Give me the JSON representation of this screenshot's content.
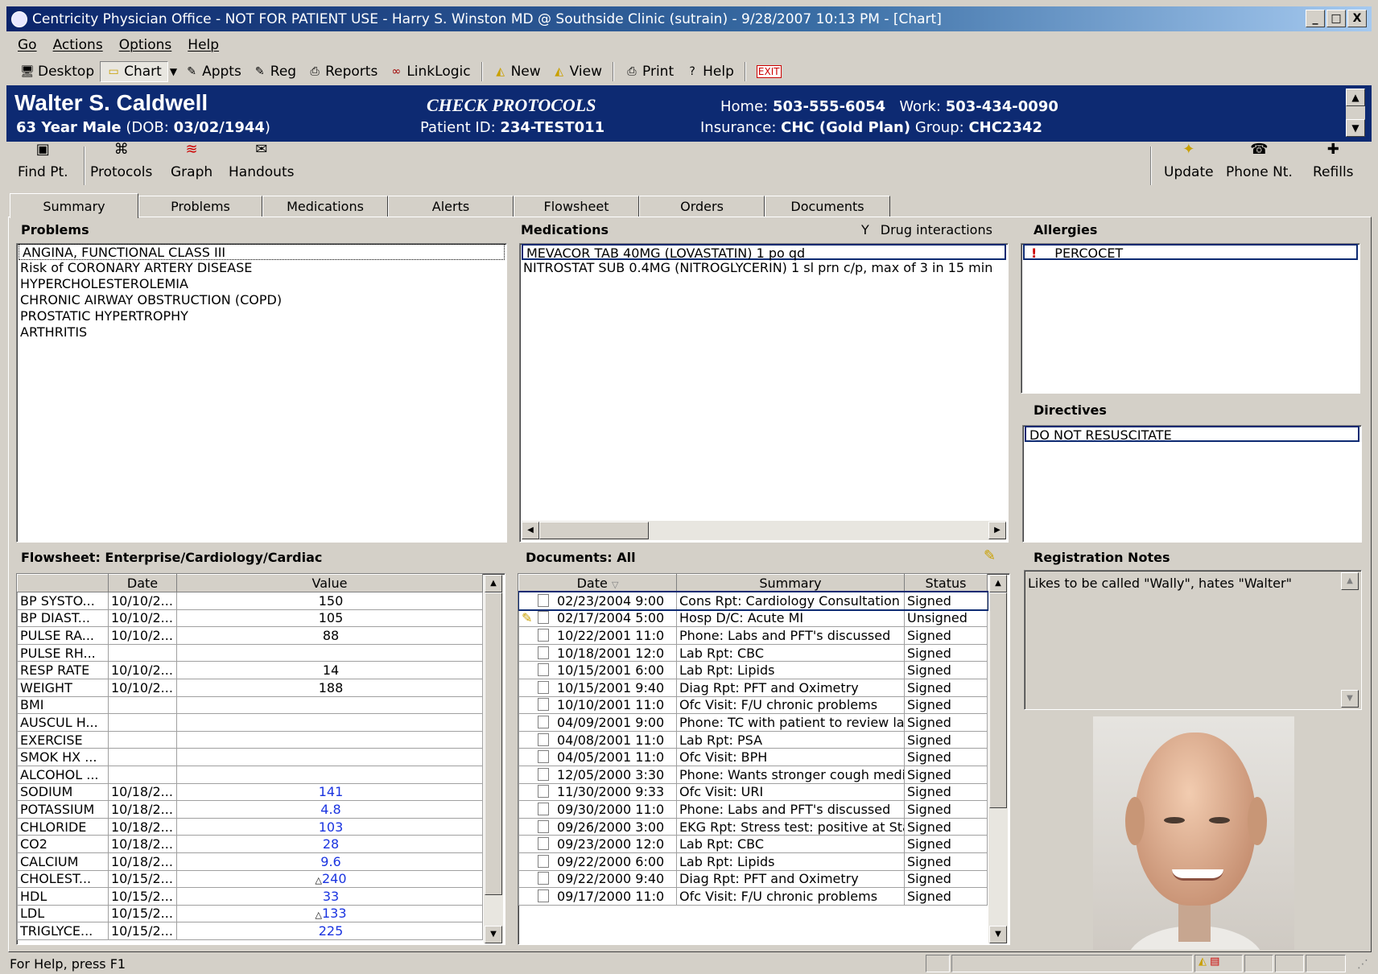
{
  "window": {
    "title": "Centricity Physician Office - NOT FOR PATIENT USE  -  Harry S. Winston MD @ Southside Clinic (sutrain)  -  9/28/2007  10:13 PM - [Chart]",
    "minimize": "_",
    "maximize": "□",
    "close": "X"
  },
  "menu": {
    "items": [
      "Go",
      "Actions",
      "Options",
      "Help"
    ]
  },
  "toolbar": {
    "desktop": "Desktop",
    "chart": "Chart",
    "appts": "Appts",
    "reg": "Reg",
    "reports": "Reports",
    "linklogic": "LinkLogic",
    "new": "New",
    "view": "View",
    "print": "Print",
    "help": "Help",
    "exit": "EXIT"
  },
  "patient": {
    "name": "Walter S. Caldwell",
    "age_sex": "63 Year Male",
    "dob_label": "(DOB: ",
    "dob": "03/02/1944",
    "dob_close": ")",
    "check_protocols": "CHECK PROTOCOLS",
    "patient_id_label": "Patient ID: ",
    "patient_id": "234-TEST011",
    "home_label": "Home: ",
    "home": "503-555-6054",
    "work_label": "Work: ",
    "work": "503-434-0090",
    "insurance_label": "Insurance: ",
    "insurance": "CHC (Gold Plan)",
    "group_label": "Group: ",
    "group": "CHC2342"
  },
  "actions": {
    "find_pt": "Find Pt.",
    "protocols": "Protocols",
    "graph": "Graph",
    "handouts": "Handouts",
    "update": "Update",
    "phone_nt": "Phone Nt.",
    "refills": "Refills"
  },
  "tabs": [
    "Summary",
    "Problems",
    "Medications",
    "Alerts",
    "Flowsheet",
    "Orders",
    "Documents"
  ],
  "problems": {
    "header": "Problems",
    "items": [
      "ANGINA, FUNCTIONAL CLASS III",
      "Risk of CORONARY ARTERY DISEASE",
      "HYPERCHOLESTEROLEMIA",
      "CHRONIC AIRWAY OBSTRUCTION (COPD)",
      "PROSTATIC HYPERTROPHY",
      "ARTHRITIS"
    ]
  },
  "medications": {
    "header": "Medications",
    "drug_interactions": "Drug interactions",
    "items": [
      "MEVACOR TAB 40MG (LOVASTATIN) 1 po qd",
      "NITROSTAT SUB 0.4MG (NITROGLYCERIN) 1 sl prn c/p, max of 3 in 15 min"
    ]
  },
  "allergies": {
    "header": "Allergies",
    "items": [
      "PERCOCET"
    ]
  },
  "directives": {
    "header": "Directives",
    "items": [
      "DO NOT RESUSCITATE"
    ]
  },
  "flowsheet": {
    "header": "Flowsheet:  Enterprise/Cardiology/Cardiac",
    "columns": [
      "",
      "Date",
      "Value"
    ],
    "rows": [
      {
        "name": "BP SYSTO...",
        "date": "10/10/2...",
        "value": "150",
        "flag": ""
      },
      {
        "name": "BP DIAST...",
        "date": "10/10/2...",
        "value": "105",
        "flag": ""
      },
      {
        "name": "PULSE RA...",
        "date": "10/10/2...",
        "value": "88",
        "flag": ""
      },
      {
        "name": "PULSE RH...",
        "date": "",
        "value": "",
        "flag": ""
      },
      {
        "name": "RESP RATE",
        "date": "10/10/2...",
        "value": "14",
        "flag": ""
      },
      {
        "name": "WEIGHT",
        "date": "10/10/2...",
        "value": "188",
        "flag": ""
      },
      {
        "name": "BMI",
        "date": "",
        "value": "",
        "flag": ""
      },
      {
        "name": "AUSCUL H...",
        "date": "",
        "value": "",
        "flag": ""
      },
      {
        "name": "EXERCISE",
        "date": "",
        "value": "",
        "flag": ""
      },
      {
        "name": "SMOK HX ...",
        "date": "",
        "value": "",
        "flag": ""
      },
      {
        "name": "ALCOHOL ...",
        "date": "",
        "value": "",
        "flag": ""
      },
      {
        "name": "SODIUM",
        "date": "10/18/2...",
        "value": "141",
        "flag": "blue"
      },
      {
        "name": "POTASSIUM",
        "date": "10/18/2...",
        "value": "4.8",
        "flag": "blue"
      },
      {
        "name": "CHLORIDE",
        "date": "10/18/2...",
        "value": "103",
        "flag": "blue"
      },
      {
        "name": "CO2",
        "date": "10/18/2...",
        "value": "28",
        "flag": "blue"
      },
      {
        "name": "CALCIUM",
        "date": "10/18/2...",
        "value": "9.6",
        "flag": "blue"
      },
      {
        "name": "CHOLEST...",
        "date": "10/15/2...",
        "value": "240",
        "flag": "high"
      },
      {
        "name": "HDL",
        "date": "10/15/2...",
        "value": "33",
        "flag": "blue"
      },
      {
        "name": "LDL",
        "date": "10/15/2...",
        "value": "133",
        "flag": "high"
      },
      {
        "name": "TRIGLYCE...",
        "date": "10/15/2...",
        "value": "225",
        "flag": "blue"
      }
    ]
  },
  "documents": {
    "header": "Documents: All",
    "columns": [
      "Date",
      "Summary",
      "Status"
    ],
    "rows": [
      {
        "date": "02/23/2004 9:00",
        "summary": "Cons Rpt: Cardiology Consultation",
        "status": "Signed",
        "edit": false
      },
      {
        "date": "02/17/2004 5:00",
        "summary": "Hosp D/C: Acute MI",
        "status": "Unsigned",
        "edit": true
      },
      {
        "date": "10/22/2001 11:0",
        "summary": "Phone: Labs and PFT's discussed",
        "status": "Signed",
        "edit": false
      },
      {
        "date": "10/18/2001 12:0",
        "summary": "Lab Rpt: CBC",
        "status": "Signed",
        "edit": false
      },
      {
        "date": "10/15/2001 6:00",
        "summary": "Lab Rpt: Lipids",
        "status": "Signed",
        "edit": false
      },
      {
        "date": "10/15/2001 9:40",
        "summary": "Diag Rpt: PFT and Oximetry",
        "status": "Signed",
        "edit": false
      },
      {
        "date": "10/10/2001 11:0",
        "summary": "Ofc Visit: F/U chronic problems",
        "status": "Signed",
        "edit": false
      },
      {
        "date": "04/09/2001 9:00",
        "summary": "Phone: TC with patient to review labs",
        "status": "Signed",
        "edit": false
      },
      {
        "date": "04/08/2001 11:0",
        "summary": "Lab Rpt: PSA",
        "status": "Signed",
        "edit": false
      },
      {
        "date": "04/05/2001 11:0",
        "summary": "Ofc Visit: BPH",
        "status": "Signed",
        "edit": false
      },
      {
        "date": "12/05/2000 3:30",
        "summary": "Phone: Wants stronger cough medic",
        "status": "Signed",
        "edit": false
      },
      {
        "date": "11/30/2000 9:33",
        "summary": "Ofc Visit: URI",
        "status": "Signed",
        "edit": false
      },
      {
        "date": "09/30/2000 11:0",
        "summary": "Phone: Labs and PFT's discussed",
        "status": "Signed",
        "edit": false
      },
      {
        "date": "09/26/2000 3:00",
        "summary": "EKG Rpt: Stress test: positive at Sta",
        "status": "Signed",
        "edit": false
      },
      {
        "date": "09/23/2000 12:0",
        "summary": "Lab Rpt: CBC",
        "status": "Signed",
        "edit": false
      },
      {
        "date": "09/22/2000 6:00",
        "summary": "Lab Rpt: Lipids",
        "status": "Signed",
        "edit": false
      },
      {
        "date": "09/22/2000 9:40",
        "summary": "Diag Rpt: PFT and Oximetry",
        "status": "Signed",
        "edit": false
      },
      {
        "date": "09/17/2000 11:0",
        "summary": "Ofc Visit: F/U chronic problems",
        "status": "Signed",
        "edit": false
      }
    ]
  },
  "registration_notes": {
    "header": "Registration Notes",
    "text": "Likes to be called \"Wally\", hates \"Walter\""
  },
  "statusbar": {
    "text": "For Help, press F1"
  },
  "colors": {
    "banner": "#0d2a72",
    "value_blue": "#1a34e0",
    "exit_red": "#cc0000"
  }
}
